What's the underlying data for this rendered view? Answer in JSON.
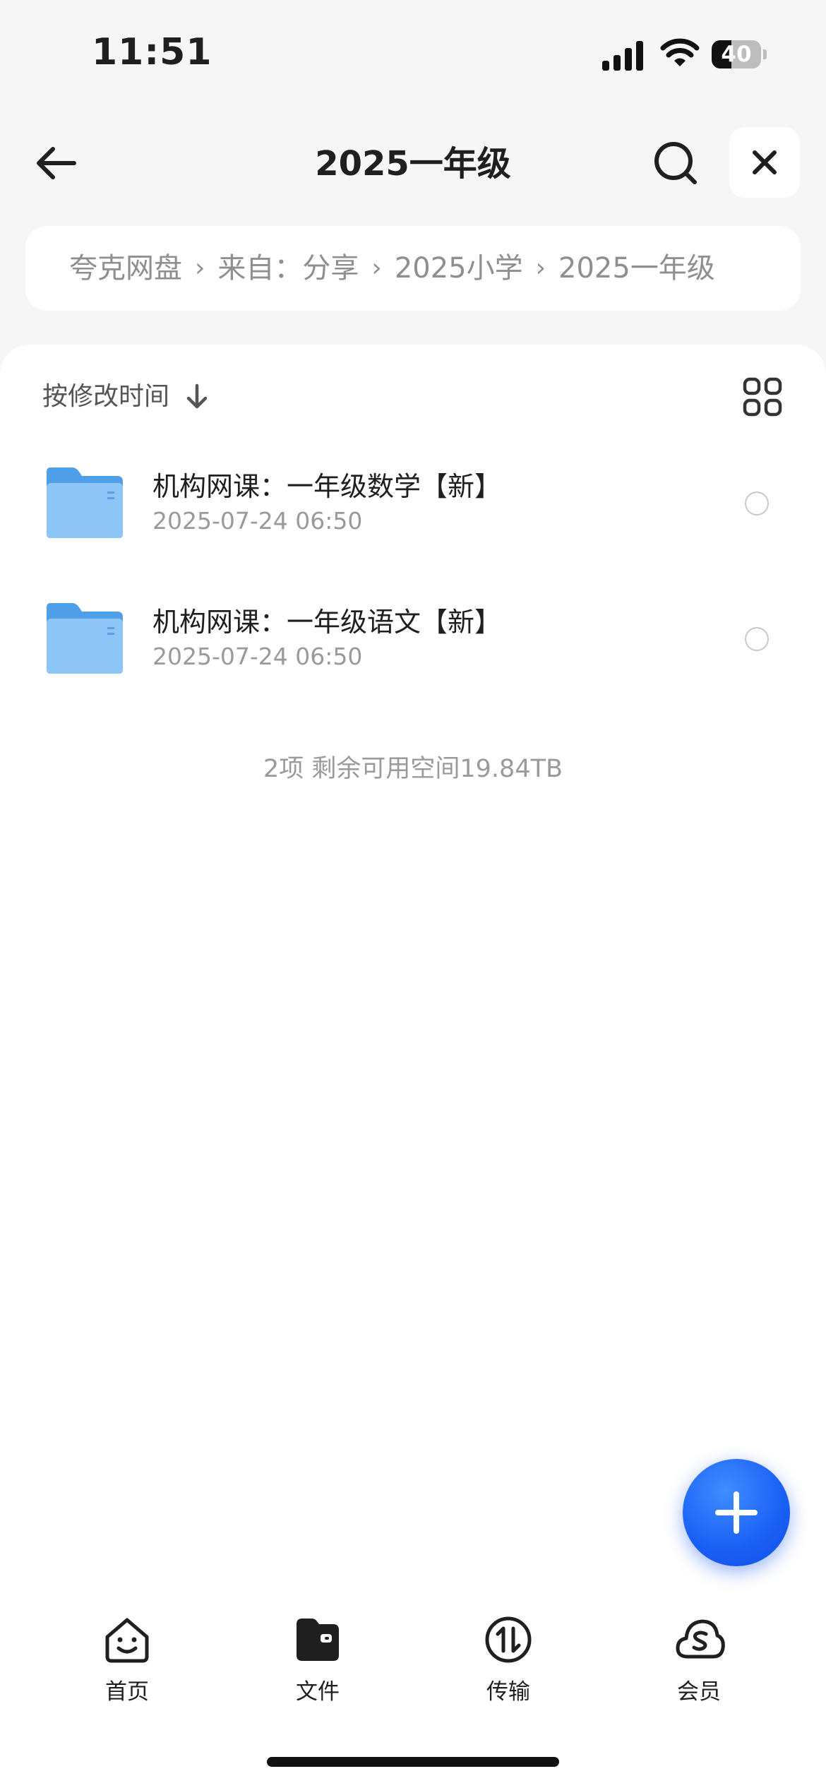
{
  "status_bar": {
    "time": "11:51",
    "battery_level": "40"
  },
  "header": {
    "title": "2025一年级"
  },
  "breadcrumb": {
    "items": [
      "夸克网盘",
      "来自：分享",
      "2025小学",
      "2025一年级"
    ]
  },
  "toolbar": {
    "sort_label": "按修改时间"
  },
  "files": [
    {
      "name": "机构网课：一年级数学【新】",
      "date": "2025-07-24 06:50"
    },
    {
      "name": "机构网课：一年级语文【新】",
      "date": "2025-07-24 06:50"
    }
  ],
  "summary": "2项 剩余可用空间19.84TB",
  "tabs": [
    {
      "label": "首页",
      "icon": "face-home-icon"
    },
    {
      "label": "文件",
      "icon": "folder-icon"
    },
    {
      "label": "传输",
      "icon": "transfer-icon"
    },
    {
      "label": "会员",
      "icon": "cloud-member-icon"
    }
  ],
  "colors": {
    "accent": "#1a5ff5",
    "folder": "#5aa9f0",
    "background": "#f6f6f6"
  }
}
